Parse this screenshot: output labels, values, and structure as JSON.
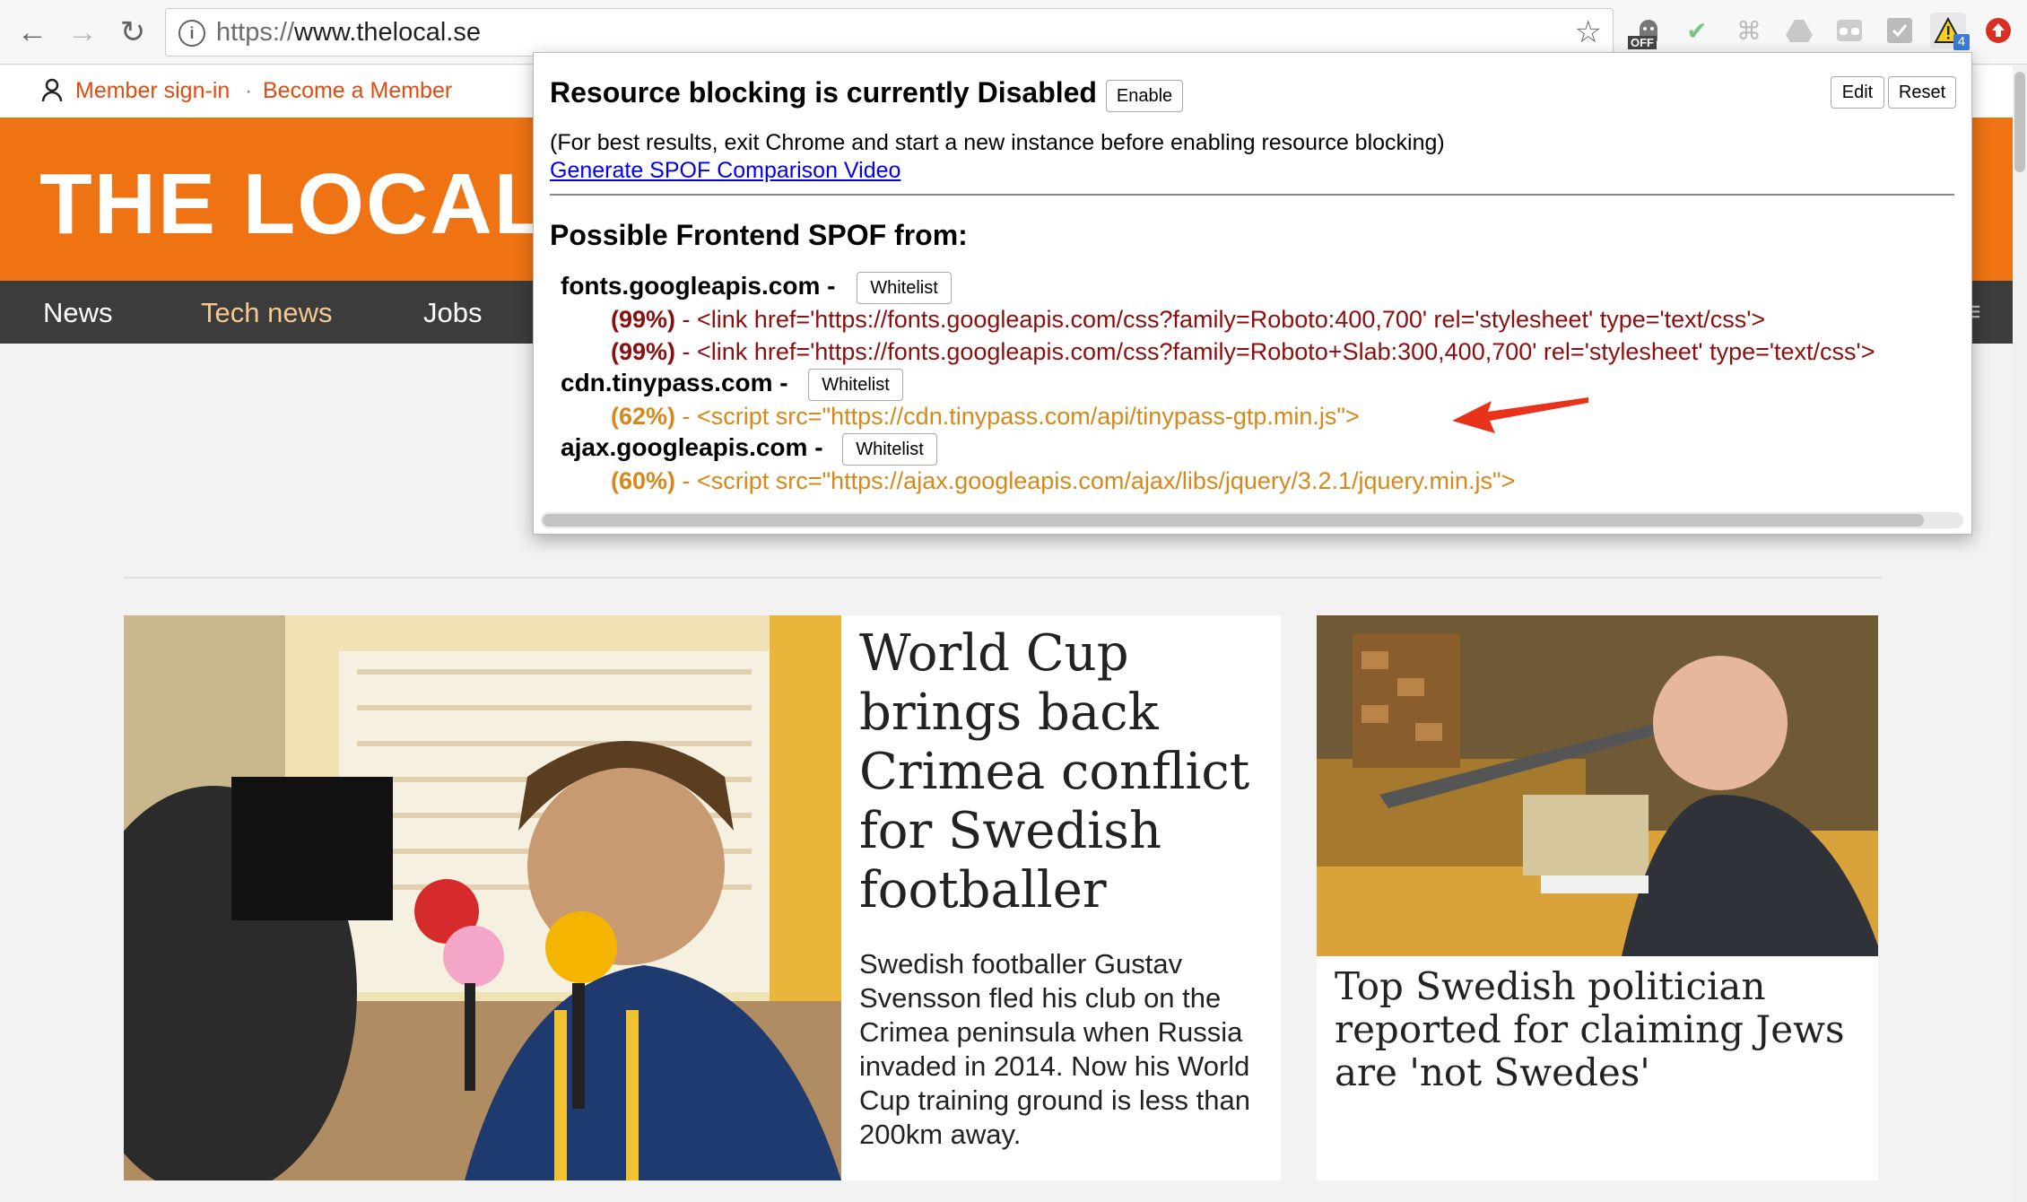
{
  "browser": {
    "url_scheme": "https://",
    "url_host": "www.thelocal.se",
    "back_icon": "←",
    "forward_icon": "→",
    "reload_icon": "↻",
    "star_icon": "☆",
    "ext_off_badge": "OFF",
    "ext_count_badge": "4"
  },
  "site": {
    "member_signin": "Member sign-in",
    "separator": "·",
    "become_member": "Become a Member",
    "logo": "THE LOCAL",
    "nav": [
      "News",
      "Tech news",
      "Jobs"
    ]
  },
  "articles": {
    "main": {
      "headline": "World Cup brings back Crimea conflict for Swedish footballer",
      "summary": "Swedish footballer Gustav Svensson fled his club on the Crimea peninsula when Russia invaded in 2014. Now his World Cup training ground is less than 200km away."
    },
    "side": {
      "headline": "Top Swedish politician reported for claiming Jews are 'not Swedes'"
    }
  },
  "popup": {
    "title": "Resource blocking is currently Disabled",
    "enable_label": "Enable",
    "edit_label": "Edit",
    "reset_label": "Reset",
    "note": "(For best results, exit Chrome and start a new instance before enabling resource blocking)",
    "video_link": "Generate SPOF Comparison Video",
    "heading": "Possible Frontend SPOF from:",
    "whitelist_label": "Whitelist",
    "domains": [
      {
        "name": "fonts.googleapis.com",
        "resources": [
          {
            "pct": "(99%)",
            "text": " - <link href='https://fonts.googleapis.com/css?family=Roboto:400,700' rel='stylesheet' type='text/css'>"
          },
          {
            "pct": "(99%)",
            "text": " - <link href='https://fonts.googleapis.com/css?family=Roboto+Slab:300,400,700' rel='stylesheet' type='text/css'>"
          }
        ]
      },
      {
        "name": "cdn.tinypass.com",
        "resources": [
          {
            "pct": "(62%)",
            "text": " - <script src=\"https://cdn.tinypass.com/api/tinypass-gtp.min.js\">"
          }
        ]
      },
      {
        "name": "ajax.googleapis.com",
        "resources": [
          {
            "pct": "(60%)",
            "text": " - <script src=\"https://ajax.googleapis.com/ajax/libs/jquery/3.2.1/jquery.min.js\">"
          }
        ]
      }
    ],
    "dash": " -"
  },
  "colors": {
    "brand_orange": "#ef7312",
    "link_orange": "#e04c0f",
    "severity_high": "#8b0f0f",
    "severity_mid": "#d6881a",
    "annotation_arrow": "#e8321c"
  }
}
